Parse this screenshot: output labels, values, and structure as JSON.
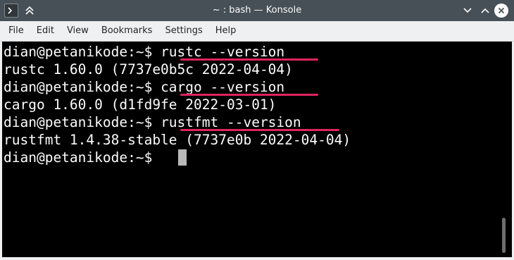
{
  "window": {
    "title": "~ : bash — Konsole",
    "app_icon": "terminal-icon",
    "pin_icon": "keep-above-icon",
    "buttons": [
      "minimize-icon",
      "maximize-icon",
      "close-icon"
    ]
  },
  "menu": {
    "items": [
      "File",
      "Edit",
      "View",
      "Bookmarks",
      "Settings",
      "Help"
    ]
  },
  "terminal": {
    "lines": [
      {
        "prompt": "dian@petanikode:~$ ",
        "command": "rustc --version"
      },
      {
        "output": "rustc 1.60.0 (7737e0b5c 2022-04-04)"
      },
      {
        "prompt": "dian@petanikode:~$ ",
        "command": "cargo --version"
      },
      {
        "output": "cargo 1.60.0 (d1fd9fe 2022-03-01)"
      },
      {
        "prompt": "dian@petanikode:~$ ",
        "command": "rustfmt --version"
      },
      {
        "output": "rustfmt 1.4.38-stable (7737e0b 2022-04-04)"
      },
      {
        "prompt": "dian@petanikode:~$ ",
        "command": ""
      }
    ]
  },
  "colors": {
    "titlebar": "#475057",
    "terminal_bg": "#000000",
    "terminal_fg": "#fcfcfc",
    "highlight_underline": "#e0245e",
    "cursor": "#b8b8b8"
  }
}
